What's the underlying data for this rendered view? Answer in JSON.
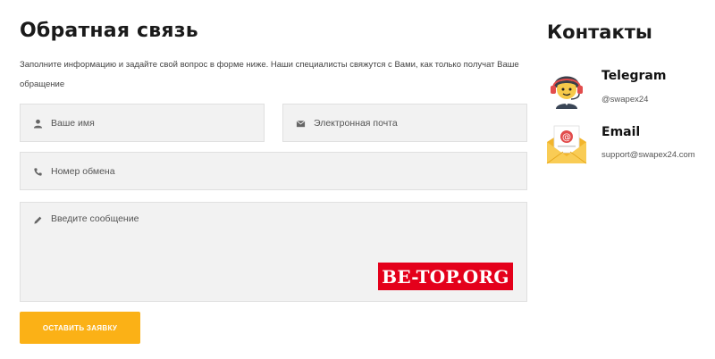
{
  "feedback": {
    "title": "Обратная связь",
    "description": "Заполните информацию и задайте свой вопрос в форме ниже. Наши специалисты свяжутся с Вами, как только получат Ваше обращение",
    "name_placeholder": "Ваше имя",
    "email_placeholder": "Электронная почта",
    "exchange_placeholder": "Номер обмена",
    "message_placeholder": "Введите сообщение",
    "submit_label": "ОСТАВИТЬ ЗАЯВКУ"
  },
  "contacts": {
    "title": "Контакты",
    "items": [
      {
        "label": "Telegram",
        "value": "@swapex24",
        "icon": "telegram-support-agent-icon"
      },
      {
        "label": "Email",
        "value": "support@swapex24.com",
        "icon": "email-envelope-icon"
      }
    ]
  },
  "watermark": "BE-TOP.ORG",
  "colors": {
    "accent": "#fbb116",
    "field_background": "#f2f2f2",
    "watermark_background": "#e4001b"
  }
}
